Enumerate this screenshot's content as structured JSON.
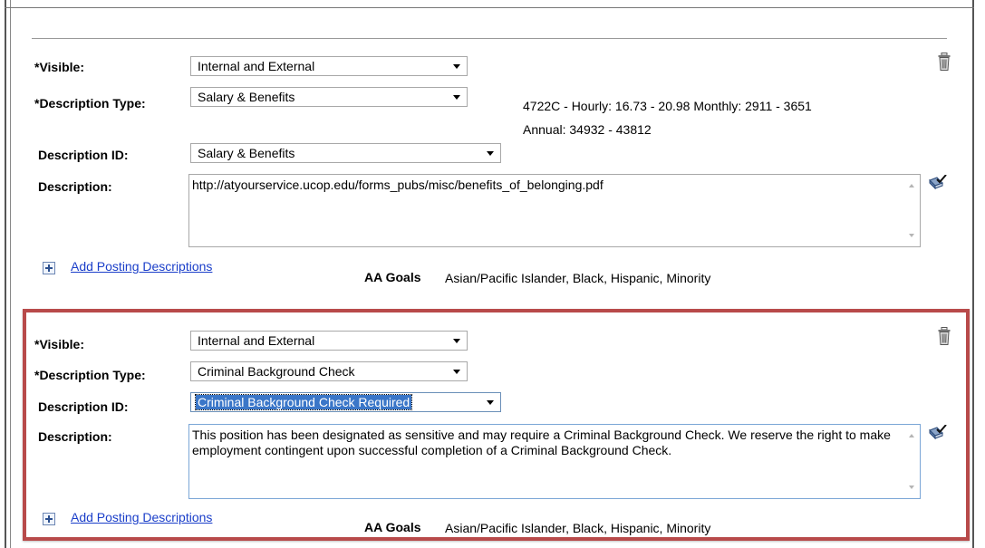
{
  "colors": {
    "highlight_border": "#b84a4a",
    "link": "#1a3ec9",
    "selection_bg": "#3a76c8"
  },
  "section1": {
    "visible_label": "*Visible:",
    "visible_value": "Internal and External",
    "desc_type_label": "*Description Type:",
    "desc_type_value": "Salary & Benefits",
    "salary_line1": "4722C - Hourly: 16.73 - 20.98  Monthly: 2911 - 3651",
    "salary_line2": "Annual: 34932 - 43812",
    "desc_id_label": "Description ID:",
    "desc_id_value": "Salary & Benefits",
    "description_label": "Description:",
    "description_value": "http://atyourservice.ucop.edu/forms_pubs/misc/benefits_of_belonging.pdf",
    "add_link": "Add Posting Descriptions",
    "aa_goals_label": "AA Goals",
    "aa_goals_value": "Asian/Pacific Islander, Black, Hispanic, Minority"
  },
  "section2": {
    "visible_label": "*Visible:",
    "visible_value": "Internal and External",
    "desc_type_label": "*Description Type:",
    "desc_type_value": "Criminal Background Check",
    "desc_id_label": "Description ID:",
    "desc_id_value": "Criminal Background Check Required",
    "description_label": "Description:",
    "description_value": "This position has been designated as sensitive and may require a Criminal Background Check. We reserve the right to make employment contingent upon successful completion of a Criminal Background Check.",
    "add_link": "Add Posting Descriptions",
    "aa_goals_label": "AA Goals",
    "aa_goals_value": "Asian/Pacific Islander, Black, Hispanic, Minority"
  }
}
